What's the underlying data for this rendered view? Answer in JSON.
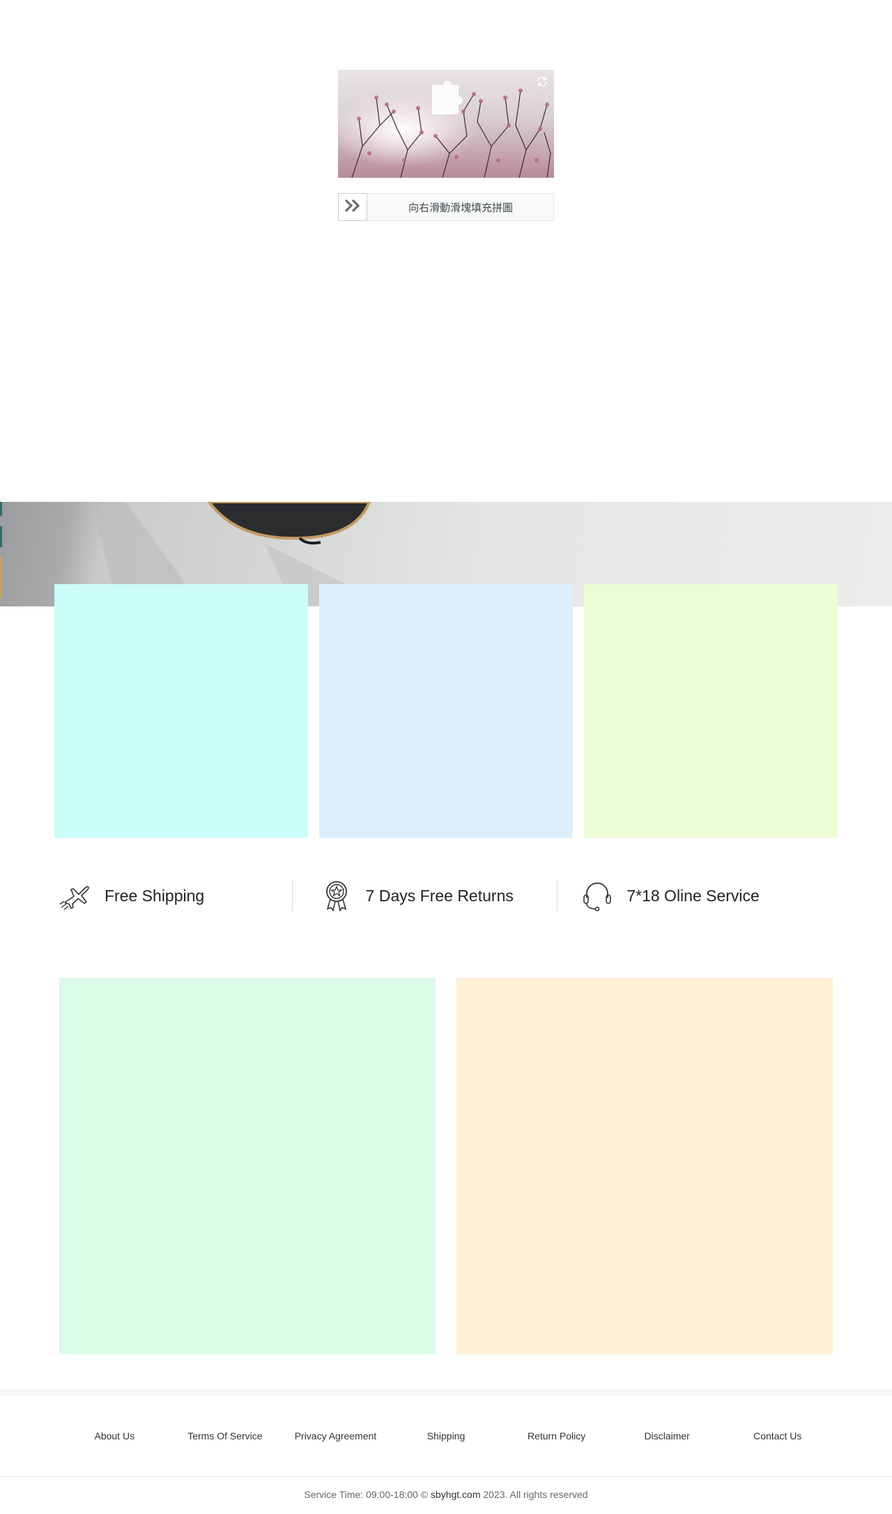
{
  "captcha": {
    "slider_text": "向右滑動滑塊填充拼圖",
    "refresh_icon": "refresh-icon",
    "handle_icon": "double-chevron-right-icon"
  },
  "services": [
    {
      "label": "Free Shipping",
      "icon": "airplane-icon"
    },
    {
      "label": "7 Days Free Returns",
      "icon": "award-medal-icon"
    },
    {
      "label": "7*18 Oline Service",
      "icon": "headset-icon"
    }
  ],
  "footer": {
    "links": [
      "About Us",
      "Terms Of Service",
      "Privacy Agreement",
      "Shipping",
      "Return Policy",
      "Disclaimer",
      "Contact Us"
    ],
    "copyright_prefix": "Service Time: 09:00-18:00 ©",
    "copyright_domain": "sbyhgt.com",
    "copyright_suffix": "2023. All rights reserved"
  },
  "colors": {
    "tile_1": "#ccfcf7",
    "tile_2": "#ddeffc",
    "tile_3": "#edfcd6",
    "promo_1": "#dbfae8",
    "promo_2": "#fdf0d4"
  }
}
